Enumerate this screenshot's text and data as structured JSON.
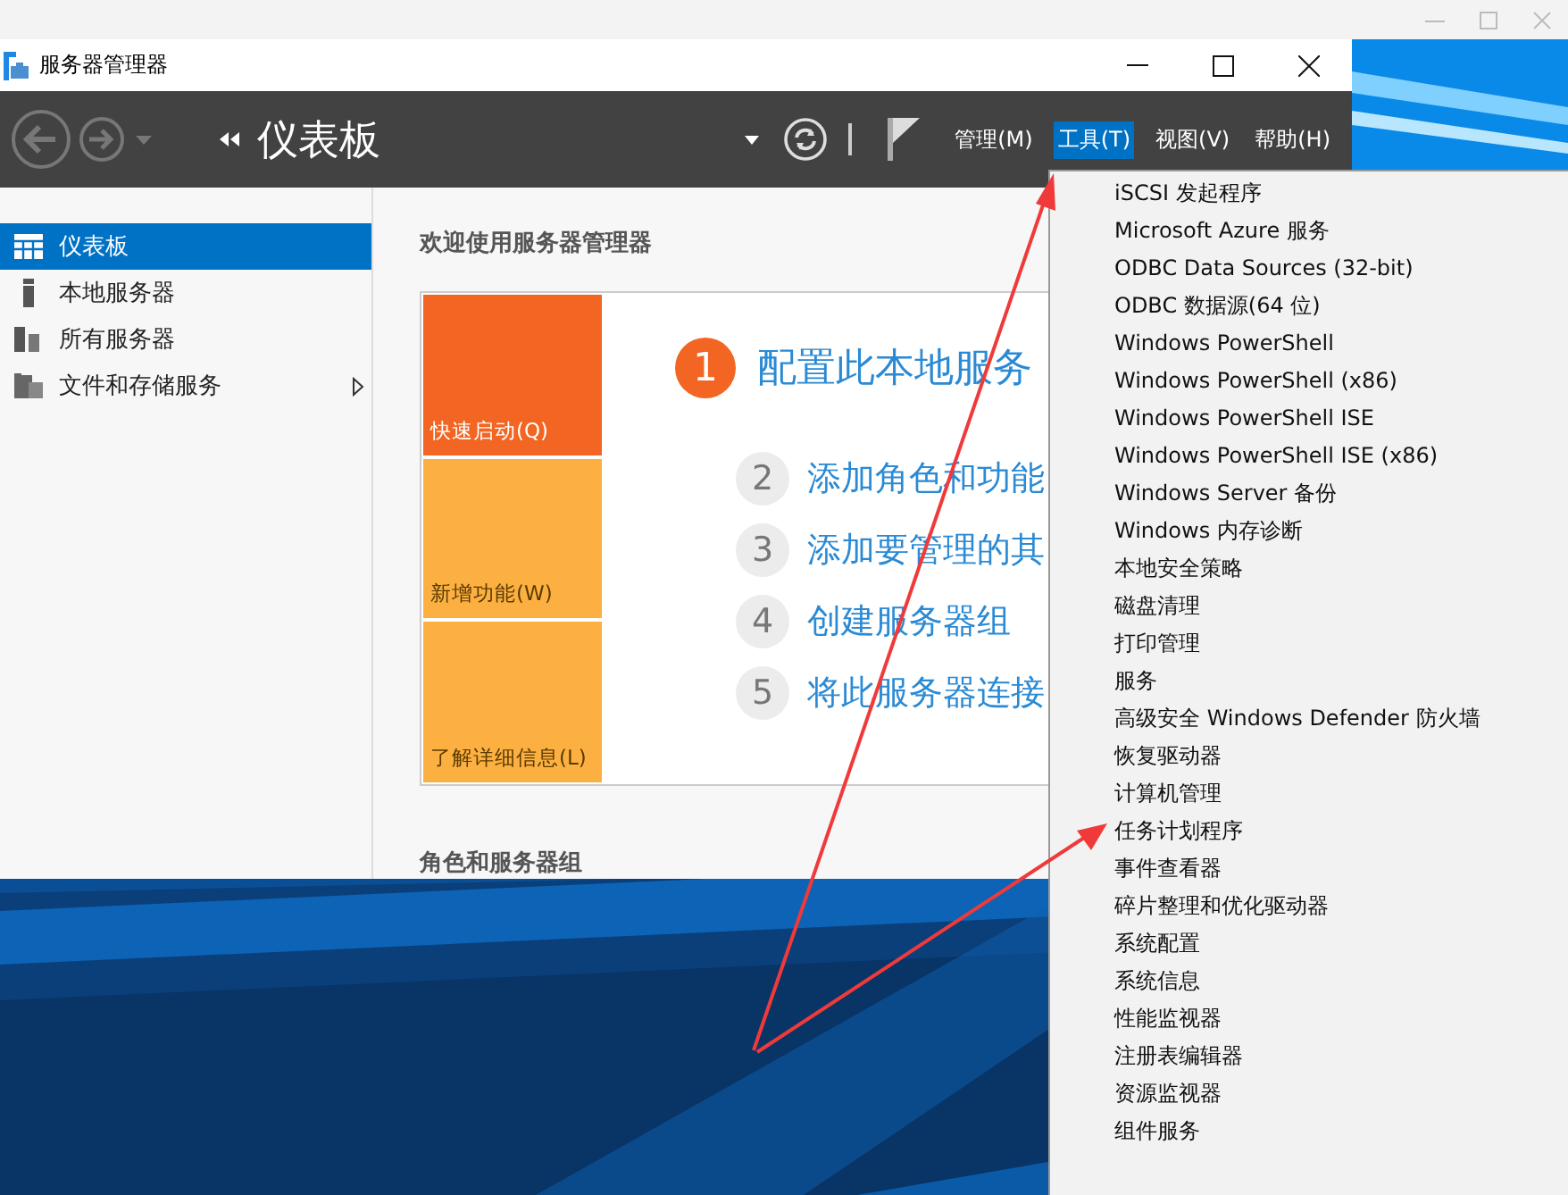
{
  "window": {
    "title": "服务器管理器"
  },
  "toolbar": {
    "title": "仪表板",
    "menus": [
      {
        "label": "管理(M)",
        "selected": false
      },
      {
        "label": "工具(T)",
        "selected": true
      },
      {
        "label": "视图(V)",
        "selected": false
      },
      {
        "label": "帮助(H)",
        "selected": false
      }
    ]
  },
  "sidebar": {
    "items": [
      {
        "label": "仪表板",
        "kind": "dashboard",
        "selected": true,
        "expandable": false
      },
      {
        "label": "本地服务器",
        "kind": "server",
        "selected": false,
        "expandable": false
      },
      {
        "label": "所有服务器",
        "kind": "servers",
        "selected": false,
        "expandable": false
      },
      {
        "label": "文件和存储服务",
        "kind": "files",
        "selected": false,
        "expandable": true
      }
    ]
  },
  "welcome": {
    "heading": "欢迎使用服务器管理器",
    "tiles": [
      {
        "label": "快速启动(Q)",
        "color": "#f26522"
      },
      {
        "label": "新增功能(W)",
        "color": "#fdb042"
      },
      {
        "label": "了解详细信息(L)",
        "color": "#fdb042"
      }
    ],
    "steps": [
      {
        "number": "1",
        "text": "配置此本地服务",
        "kind": "primary"
      },
      {
        "number": "2",
        "text": "添加角色和功能",
        "kind": "secondary"
      },
      {
        "number": "3",
        "text": "添加要管理的其",
        "kind": "secondary"
      },
      {
        "number": "4",
        "text": "创建服务器组",
        "kind": "secondary"
      },
      {
        "number": "5",
        "text": "将此服务器连接",
        "kind": "secondary"
      }
    ],
    "next_heading": "角色和服务器组"
  },
  "tools_menu": {
    "items": [
      "iSCSI 发起程序",
      "Microsoft Azure 服务",
      "ODBC Data Sources (32-bit)",
      "ODBC 数据源(64 位)",
      "Windows PowerShell",
      "Windows PowerShell (x86)",
      "Windows PowerShell ISE",
      "Windows PowerShell ISE (x86)",
      "Windows Server 备份",
      "Windows 内存诊断",
      "本地安全策略",
      "磁盘清理",
      "打印管理",
      "服务",
      "高级安全 Windows Defender 防火墙",
      "恢复驱动器",
      "计算机管理",
      "任务计划程序",
      "事件查看器",
      "碎片整理和优化驱动器",
      "系统配置",
      "系统信息",
      "性能监视器",
      "注册表编辑器",
      "资源监视器",
      "组件服务"
    ]
  }
}
